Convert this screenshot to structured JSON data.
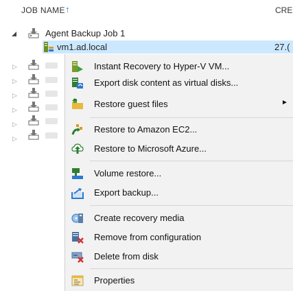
{
  "header": {
    "job_name": "JOB NAME",
    "sort_arrow": "↑",
    "created_col": "CRE"
  },
  "tree": {
    "job": {
      "label": "Agent Backup Job 1",
      "icon": "agent-backup-icon"
    },
    "vm": {
      "label": "vm1.ad.local",
      "date": "27.(",
      "icon": "vm-disk-icon"
    }
  },
  "menu": {
    "items": [
      {
        "label": "Instant Recovery to Hyper-V VM...",
        "icon": "instant-recovery-icon"
      },
      {
        "label": "Export disk content as virtual disks...",
        "icon": "export-disk-icon"
      },
      {
        "label": "Restore guest files",
        "icon": "restore-guest-files-icon",
        "submenu": "►"
      },
      {
        "label": "Restore to Amazon EC2...",
        "icon": "amazon-ec2-icon"
      },
      {
        "label": "Restore to Microsoft Azure...",
        "icon": "azure-icon"
      },
      {
        "label": "Volume restore...",
        "icon": "volume-restore-icon"
      },
      {
        "label": "Export backup...",
        "icon": "export-backup-icon"
      },
      {
        "label": "Create recovery media",
        "icon": "recovery-media-icon"
      },
      {
        "label": "Remove from configuration",
        "icon": "remove-config-icon"
      },
      {
        "label": "Delete from disk",
        "icon": "delete-disk-icon"
      },
      {
        "label": "Properties",
        "icon": "properties-icon"
      }
    ]
  }
}
